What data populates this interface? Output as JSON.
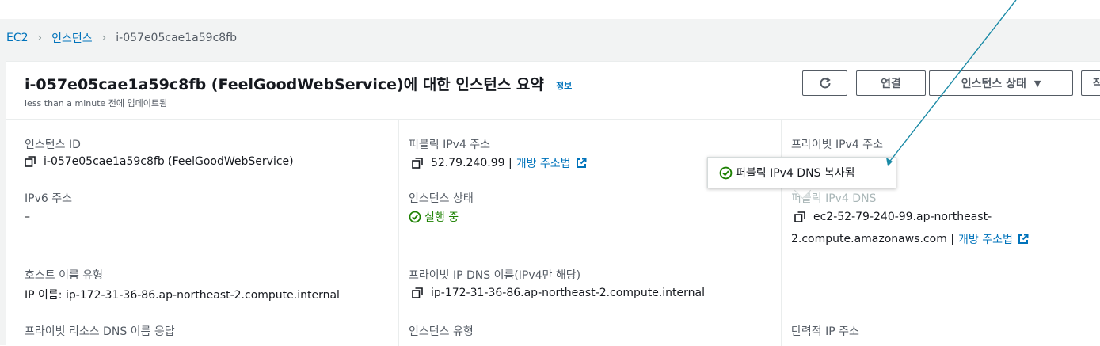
{
  "breadcrumb": {
    "root": "EC2",
    "level1": "인스턴스",
    "current": "i-057e05cae1a59c8fb"
  },
  "header": {
    "title": "i-057e05cae1a59c8fb (FeelGoodWebService)에 대한 인스턴스 요약",
    "info": "정보",
    "subtitle": "less than a minute 전에 업데이트됨",
    "connect_label": "연결",
    "instance_state_label": "인스턴스 상태",
    "more_label": "작"
  },
  "details": {
    "instance_id_label": "인스턴스 ID",
    "instance_id_value": "i-057e05cae1a59c8fb (FeelGoodWebService)",
    "public_ipv4_label": "퍼블릭 IPv4 주소",
    "public_ipv4_value": "52.79.240.99 |",
    "open_address": "개방 주소법",
    "private_ipv4_label": "프라이빗 IPv4 주소",
    "ipv6_label": "IPv6 주소",
    "ipv6_value": "–",
    "instance_state_label": "인스턴스 상태",
    "instance_state_value": "실행 중",
    "public_dns_label": "퍼블릭 IPv4 DNS",
    "public_dns_line1": "ec2-52-79-240-99.ap-northeast-",
    "public_dns_line2": "2.compute.amazonaws.com |",
    "hostname_type_label": "호스트 이름 유형",
    "hostname_type_value": "IP 이름: ip-172-31-36-86.ap-northeast-2.compute.internal",
    "private_ip_dns_label": "프라이빗 IP DNS 이름(IPv4만 해당)",
    "private_ip_dns_value": "ip-172-31-36-86.ap-northeast-2.compute.internal",
    "private_resource_dns_label": "프라이빗 리소스 DNS 이름 응답",
    "instance_type_label": "인스턴스 유형",
    "elastic_ip_label": "탄력적 IP 주소"
  },
  "toast": {
    "message": "퍼블릭 IPv4 DNS 복사됨"
  },
  "colors": {
    "link": "#0073bb",
    "success": "#1d8102",
    "annotation": "#1a8aa6"
  }
}
